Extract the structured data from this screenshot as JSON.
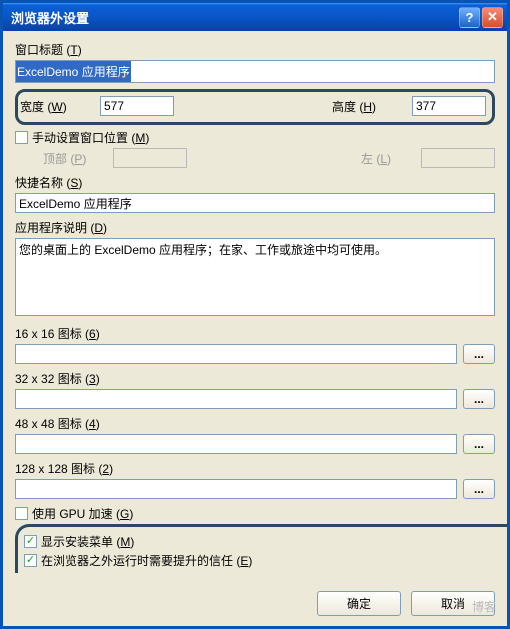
{
  "window": {
    "title": "浏览器外设置"
  },
  "labels": {
    "windowTitle": "窗口标题",
    "windowTitle_m": "T",
    "width": "宽度",
    "width_m": "W",
    "height": "高度",
    "height_m": "H",
    "manualPos": "手动设置窗口位置",
    "manualPos_m": "M",
    "top": "顶部",
    "top_m": "P",
    "left": "左",
    "left_m": "L",
    "shortcut": "快捷名称",
    "shortcut_m": "S",
    "appDesc": "应用程序说明",
    "appDesc_m": "D",
    "icon16": "16 x 16 图标",
    "icon16_m": "6",
    "icon32": "32 x 32 图标",
    "icon32_m": "3",
    "icon48": "48 x 48 图标",
    "icon48_m": "4",
    "icon128": "128 x 128 图标",
    "icon128_m": "2",
    "gpu": "使用 GPU 加速",
    "gpu_m": "G",
    "showInstall": "显示安装菜单",
    "showInstall_m": "M",
    "elevated": "在浏览器之外运行时需要提升的信任",
    "elevated_m": "E",
    "browse": "..."
  },
  "values": {
    "windowTitle": "ExcelDemo 应用程序",
    "width": "577",
    "height": "377",
    "top": "",
    "left": "",
    "shortcut": "ExcelDemo 应用程序",
    "appDesc": "您的桌面上的 ExcelDemo 应用程序；在家、工作或旅途中均可使用。",
    "icon16": "",
    "icon32": "",
    "icon48": "",
    "icon128": ""
  },
  "checks": {
    "manualPos": false,
    "gpu": false,
    "showInstall": true,
    "elevated": true
  },
  "buttons": {
    "ok": "确定",
    "cancel": "取消"
  },
  "watermark": "博客"
}
